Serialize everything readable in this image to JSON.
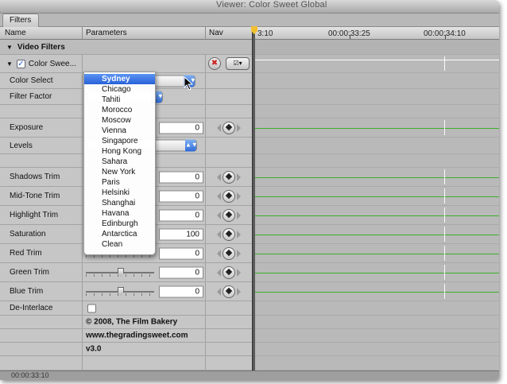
{
  "window": {
    "title": "Viewer: Color Sweet Global"
  },
  "tabs": [
    {
      "label": "Filters"
    }
  ],
  "columns": {
    "name": "Name",
    "parameters": "Parameters",
    "nav": "Nav"
  },
  "timeline": {
    "ticks": [
      "3:10",
      "00:00:33:25",
      "00:00:34:10"
    ]
  },
  "filter": {
    "section": "Video Filters",
    "name": "Color Swee..."
  },
  "params": {
    "color_select": {
      "label": "Color Select"
    },
    "filter_factor": {
      "label": "Filter Factor"
    },
    "exposure": {
      "label": "Exposure",
      "value": "0"
    },
    "levels": {
      "label": "Levels"
    },
    "shadows_trim": {
      "label": "Shadows Trim",
      "value": "0"
    },
    "midtone_trim": {
      "label": "Mid-Tone Trim",
      "value": "0"
    },
    "highlight_trim": {
      "label": "Highlight Trim",
      "value": "0"
    },
    "saturation": {
      "label": "Saturation",
      "value": "100"
    },
    "red_trim": {
      "label": "Red Trim",
      "value": "0"
    },
    "green_trim": {
      "label": "Green Trim",
      "value": "0"
    },
    "blue_trim": {
      "label": "Blue Trim",
      "value": "0"
    },
    "deinterlace": {
      "label": "De-Interlace"
    }
  },
  "footer": {
    "copyright": "© 2008, The Film Bakery",
    "url": "www.thegradingsweet.com",
    "version": "v3.0"
  },
  "dropdown": {
    "selected": "Sydney",
    "items": [
      "Sydney",
      "Chicago",
      "Tahiti",
      "Morocco",
      "Moscow",
      "Vienna",
      "Singapore",
      "Hong Kong",
      "Sahara",
      "New York",
      "Paris",
      "Helsinki",
      "Shanghai",
      "Havana",
      "Edinburgh",
      "Antarctica",
      "Clean"
    ]
  },
  "status": {
    "timecode": "00:00:33:10"
  },
  "colors": {
    "keyframe_line": "#3dae2b",
    "menu_highlight": "#2761d9"
  }
}
